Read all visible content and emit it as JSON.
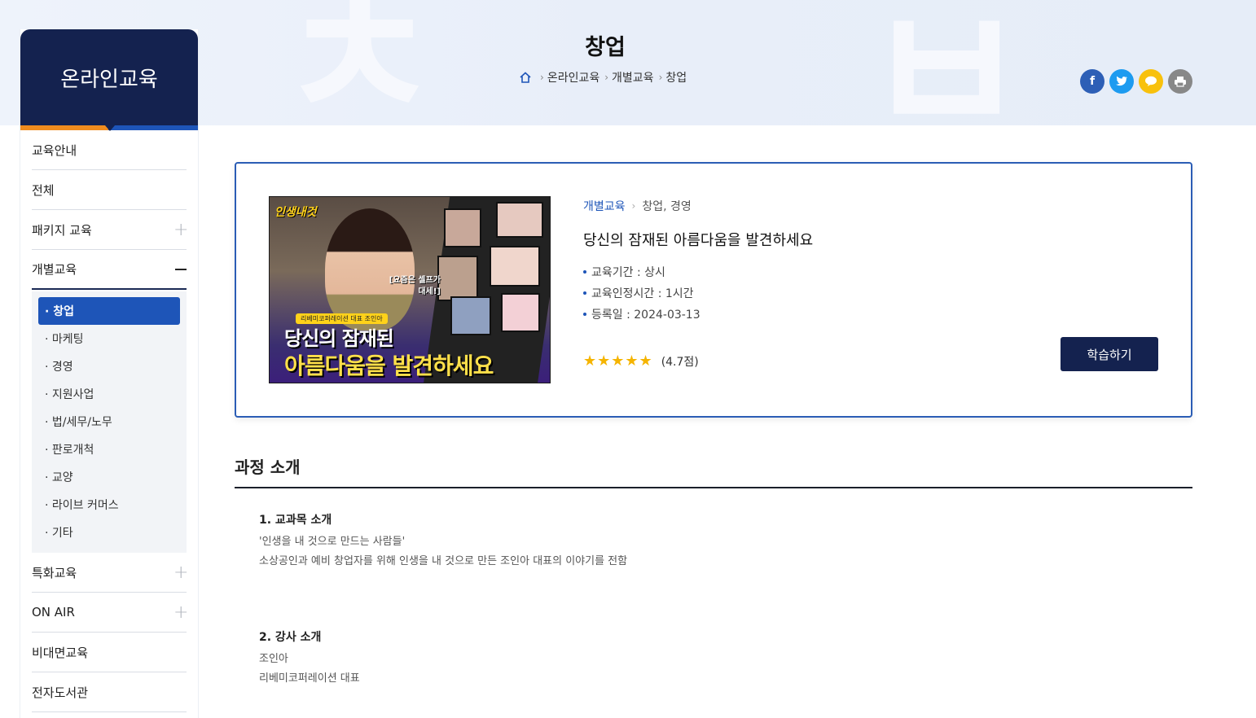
{
  "header": {
    "title": "창업",
    "breadcrumb": [
      "온라인교육",
      "개별교육",
      "창업"
    ]
  },
  "share": [
    {
      "name": "facebook",
      "glyph": "f",
      "color": "#2d5fb6"
    },
    {
      "name": "twitter",
      "glyph": "t",
      "color": "#1d9bf0"
    },
    {
      "name": "kakaotalk",
      "glyph": "●",
      "color": "#f8c10d"
    },
    {
      "name": "print",
      "glyph": "▤",
      "color": "#888888"
    }
  ],
  "sidebar": {
    "title": "온라인교육",
    "items": [
      {
        "label": "교육안내",
        "toggle": ""
      },
      {
        "label": "전체",
        "toggle": ""
      },
      {
        "label": "패키지 교육",
        "toggle": "+"
      },
      {
        "label": "개별교육",
        "toggle": "-"
      }
    ],
    "submenu": [
      "· 창업",
      "· 마케팅",
      "· 경영",
      "· 지원사업",
      "· 법/세무/노무",
      "· 판로개척",
      "· 교양",
      "· 라이브 커머스",
      "· 기타"
    ],
    "items_after": [
      {
        "label": "특화교육",
        "toggle": "+"
      },
      {
        "label": "ON AIR",
        "toggle": "+"
      },
      {
        "label": "비대면교육",
        "toggle": ""
      },
      {
        "label": "전자도서관",
        "toggle": ""
      }
    ]
  },
  "course": {
    "category": "개별교육",
    "subcategory": "창업, 경영",
    "title": "당신의 잠재된 아름다움을 발견하세요",
    "meta": [
      "교육기간 : 상시",
      "교육인정시간 : 1시간",
      "등록일 : 2024-03-13"
    ],
    "stars": "★★★★★",
    "rating": "(4.7점)",
    "button": "학습하기",
    "thumbnail": {
      "tag": "인생내것",
      "pill": "리베미코퍼레이션 대표 조인아",
      "bubble": "[요즘은 셀프가 대세!]",
      "caption1": "당신의 잠재된",
      "caption2": "아름다움을 발견하세요"
    }
  },
  "intro": {
    "title": "과정 소개",
    "blocks": [
      {
        "heading": "1. 교과목 소개",
        "lines": [
          "'인생을 내 것으로 만드는 사람들'",
          "소상공인과 예비 창업자를 위해 인생을 내 것으로 만든 조인아 대표의 이야기를 전함"
        ]
      },
      {
        "heading": "2. 강사 소개",
        "lines": [
          "조인아",
          "리베미코퍼레이션 대표"
        ]
      }
    ]
  }
}
